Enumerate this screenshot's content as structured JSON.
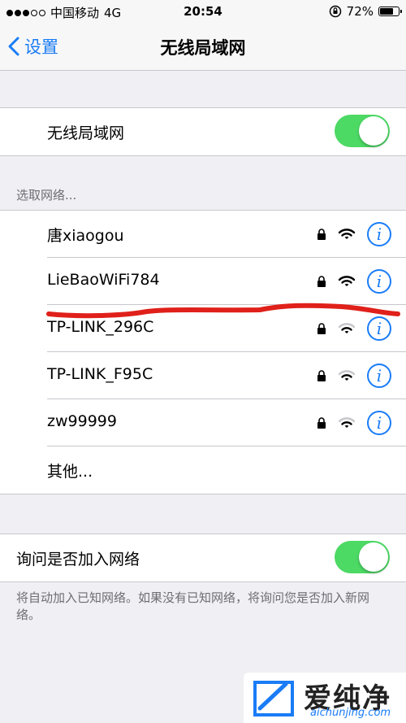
{
  "status_bar": {
    "carrier": "中国移动",
    "network": "4G",
    "time": "20:54",
    "battery": "72%",
    "battery_level": 0.72
  },
  "nav": {
    "back_label": "设置",
    "title": "无线局域网"
  },
  "wifi_toggle": {
    "label": "无线局域网",
    "on": true
  },
  "section_header": "选取网络...",
  "networks": [
    {
      "name": "唐xiaogou",
      "locked": true
    },
    {
      "name": "LieBaoWiFi784",
      "locked": true
    },
    {
      "name": "TP-LINK_296C",
      "locked": true
    },
    {
      "name": "TP-LINK_F95C",
      "locked": true
    },
    {
      "name": "zw99999",
      "locked": true
    }
  ],
  "other_label": "其他...",
  "ask_join": {
    "label": "询问是否加入网络",
    "on": true
  },
  "footer_note": "将自动加入已知网络。如果没有已知网络，将询问您是否加入新网络。",
  "watermark": {
    "text": "爱纯净",
    "url": "aichunjing.com"
  },
  "colors": {
    "accent": "#1a7cf6",
    "toggle_on": "#4cd964",
    "annotation_line": "#e0201a"
  }
}
